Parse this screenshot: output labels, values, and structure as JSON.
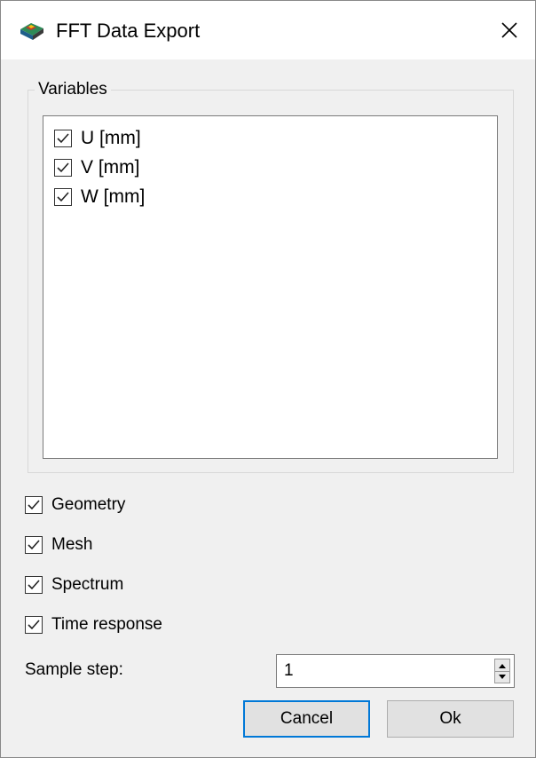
{
  "window": {
    "title": "FFT Data Export",
    "close_glyph": "✕"
  },
  "variables": {
    "legend": "Variables",
    "items": [
      {
        "label": "U [mm]",
        "checked": true
      },
      {
        "label": "V [mm]",
        "checked": true
      },
      {
        "label": "W [mm]",
        "checked": true
      }
    ]
  },
  "options": {
    "geometry": {
      "label": "Geometry",
      "checked": true
    },
    "mesh": {
      "label": "Mesh",
      "checked": true
    },
    "spectrum": {
      "label": "Spectrum",
      "checked": true
    },
    "time_response": {
      "label": "Time response",
      "checked": true
    }
  },
  "sample_step": {
    "label": "Sample step:",
    "value": "1"
  },
  "buttons": {
    "cancel": "Cancel",
    "ok": "Ok"
  },
  "colors": {
    "focus_border": "#0078d7",
    "dialog_bg": "#f0f0f0"
  }
}
